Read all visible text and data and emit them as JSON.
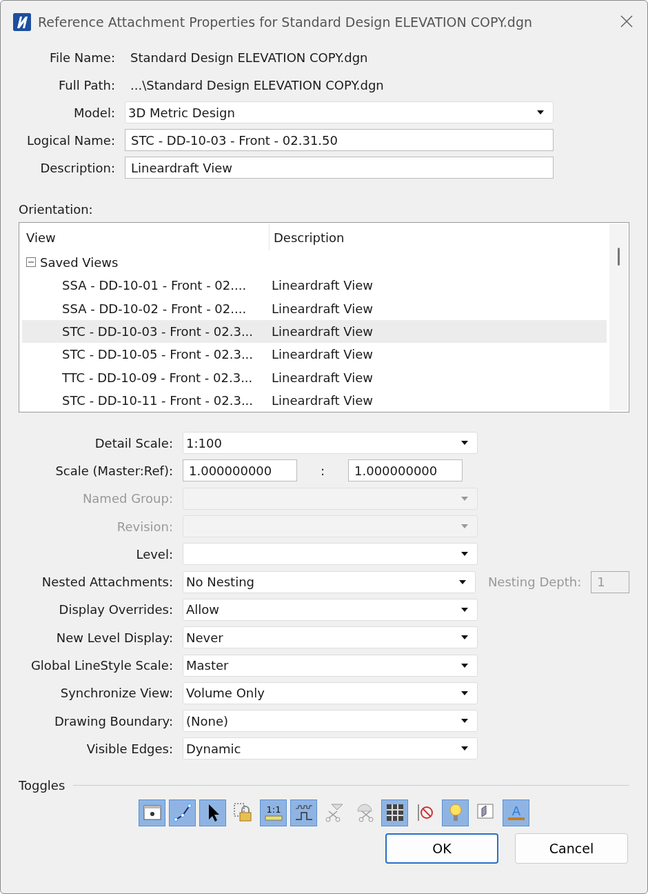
{
  "window": {
    "title": "Reference Attachment Properties for Standard Design ELEVATION COPY.dgn"
  },
  "file_info": [
    {
      "label": "File Name:",
      "value": "Standard Design ELEVATION COPY.dgn"
    },
    {
      "label": "Full Path:",
      "value": "...\\Standard Design ELEVATION COPY.dgn"
    }
  ],
  "fields": [
    {
      "label": "Model:",
      "kind": "dropdown",
      "value": "3D Metric Design"
    },
    {
      "label": "Logical Name:",
      "kind": "text",
      "value": "STC - DD-10-03 - Front - 02.31.50"
    },
    {
      "label": "Description:",
      "kind": "text",
      "value": "Lineardraft View"
    }
  ],
  "orientation": {
    "label": "Orientation:",
    "columns": [
      "View",
      "Description"
    ],
    "group": {
      "label": "Saved Views",
      "expanded": true,
      "children": [
        {
          "view": "SSA - DD-10-01 - Front - 02....",
          "description": "Lineardraft View",
          "selected": false
        },
        {
          "view": "SSA - DD-10-02 - Front - 02....",
          "description": "Lineardraft View",
          "selected": false
        },
        {
          "view": "STC - DD-10-03 - Front - 02.3...",
          "description": "Lineardraft View",
          "selected": true
        },
        {
          "view": "STC - DD-10-05 - Front - 02.3...",
          "description": "Lineardraft View",
          "selected": false
        },
        {
          "view": "TTC - DD-10-09 - Front - 02.3...",
          "description": "Lineardraft View",
          "selected": false
        },
        {
          "view": "STC - DD-10-11 - Front - 02.3...",
          "description": "Lineardraft View",
          "selected": false
        }
      ]
    }
  },
  "settings": [
    {
      "label": "Detail Scale:",
      "kind": "dropdown",
      "value": "1:100",
      "disabled": false
    },
    {
      "label": "Scale (Master:Ref):",
      "kind": "ratio",
      "value": "1.000000000",
      "separator": ":",
      "value2": "1.000000000",
      "disabled": false
    },
    {
      "label": "Named Group:",
      "kind": "dropdown",
      "disabled": true
    },
    {
      "label": "Revision:",
      "kind": "dropdown",
      "disabled": true
    },
    {
      "label": "Level:",
      "kind": "dropdown",
      "disabled": false
    },
    {
      "label": "Nested Attachments:",
      "kind": "dropdown",
      "value": "No Nesting",
      "disabled": false,
      "extra_label": "Nesting Depth:",
      "extra_value": "1",
      "extra_disabled": true
    },
    {
      "label": "Display Overrides:",
      "kind": "dropdown",
      "value": "Allow",
      "disabled": false
    },
    {
      "label": "New Level Display:",
      "kind": "dropdown",
      "value": "Never",
      "disabled": false
    },
    {
      "label": "Global LineStyle Scale:",
      "kind": "dropdown",
      "value": "Master",
      "disabled": false
    },
    {
      "label": "Synchronize View:",
      "kind": "dropdown",
      "value": "Volume Only",
      "disabled": false
    },
    {
      "label": "Drawing Boundary:",
      "kind": "dropdown",
      "value": "(None)",
      "disabled": false
    },
    {
      "label": "Visible Edges:",
      "kind": "dropdown",
      "value": "Dynamic",
      "disabled": false
    }
  ],
  "toggles": {
    "label": "Toggles",
    "items": [
      {
        "kind": "display",
        "on": true
      },
      {
        "kind": "snap",
        "on": true
      },
      {
        "kind": "locate",
        "on": true
      },
      {
        "kind": "lock",
        "on": false
      },
      {
        "kind": "scale",
        "on": true,
        "text": "1:1"
      },
      {
        "kind": "linestyle",
        "on": true
      },
      {
        "kind": "clip",
        "on": false
      },
      {
        "kind": "clip2",
        "on": false
      },
      {
        "kind": "raster",
        "on": true
      },
      {
        "kind": "noboundary",
        "on": false
      },
      {
        "kind": "light",
        "on": true
      },
      {
        "kind": "cube",
        "on": false
      },
      {
        "kind": "annotation",
        "on": true,
        "text": "A"
      }
    ]
  },
  "buttons": [
    {
      "label": "OK",
      "default": true
    },
    {
      "label": "Cancel",
      "default": false
    }
  ]
}
